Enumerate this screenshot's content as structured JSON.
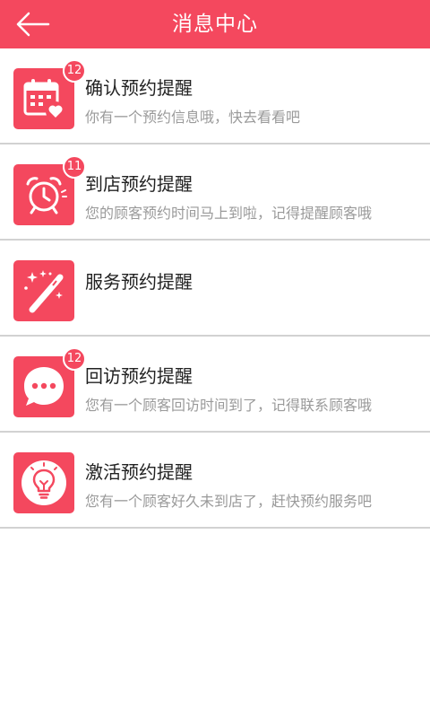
{
  "header": {
    "title": "消息中心",
    "back_icon": "arrow-left-icon",
    "background": "#f4485e"
  },
  "items": [
    {
      "icon": "calendar-heart-icon",
      "badge": "12",
      "title": "确认预约提醒",
      "subtitle": "你有一个预约信息哦，快去看看吧"
    },
    {
      "icon": "alarm-clock-icon",
      "badge": "11",
      "title": "到店预约提醒",
      "subtitle": "您的顾客预约时间马上到啦，记得提醒顾客哦"
    },
    {
      "icon": "magic-wand-icon",
      "badge": "",
      "title": "服务预约提醒",
      "subtitle": ""
    },
    {
      "icon": "chat-bubble-icon",
      "badge": "12",
      "title": "回访预约提醒",
      "subtitle": "您有一个顾客回访时间到了，记得联系顾客哦"
    },
    {
      "icon": "lightbulb-icon",
      "badge": "",
      "title": "激活预约提醒",
      "subtitle": "您有一个顾客好久未到店了，赶快预约服务吧"
    }
  ]
}
